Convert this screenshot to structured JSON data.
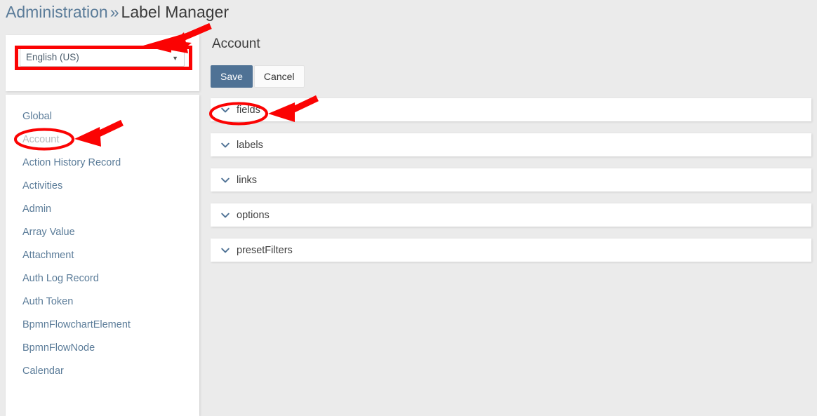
{
  "breadcrumb": {
    "root": "Administration",
    "separator": "»",
    "current": "Label Manager"
  },
  "language_selector": {
    "name": "language-select",
    "selected": "English (US)",
    "caret": "▼"
  },
  "sidebar": {
    "items": [
      {
        "label": "Global",
        "active": false
      },
      {
        "label": "Account",
        "active": true
      },
      {
        "label": "Action History Record",
        "active": false
      },
      {
        "label": "Activities",
        "active": false
      },
      {
        "label": "Admin",
        "active": false
      },
      {
        "label": "Array Value",
        "active": false
      },
      {
        "label": "Attachment",
        "active": false
      },
      {
        "label": "Auth Log Record",
        "active": false
      },
      {
        "label": "Auth Token",
        "active": false
      },
      {
        "label": "BpmnFlowchartElement",
        "active": false
      },
      {
        "label": "BpmnFlowNode",
        "active": false
      },
      {
        "label": "Calendar",
        "active": false
      }
    ]
  },
  "main": {
    "title": "Account",
    "buttons": {
      "save": "Save",
      "cancel": "Cancel"
    },
    "panels": [
      {
        "label": "fields",
        "icon": "chevron-down-icon"
      },
      {
        "label": "labels",
        "icon": "chevron-down-icon"
      },
      {
        "label": "links",
        "icon": "chevron-down-icon"
      },
      {
        "label": "options",
        "icon": "chevron-down-icon"
      },
      {
        "label": "presetFilters",
        "icon": "chevron-down-icon"
      }
    ]
  },
  "annotations": {
    "color": "#fb0303",
    "shapes": [
      {
        "type": "rectangle",
        "target": "language-select"
      },
      {
        "type": "arrow",
        "target": "language-select"
      },
      {
        "type": "ellipse",
        "target": "sidebar-item-account"
      },
      {
        "type": "arrow",
        "target": "sidebar-item-account"
      },
      {
        "type": "ellipse",
        "target": "panel-fields"
      },
      {
        "type": "arrow",
        "target": "panel-fields"
      }
    ]
  },
  "colors": {
    "page_background": "#ebebeb",
    "panel_background": "#ffffff",
    "link": "#5b7c99",
    "primary_button": "#4f7295",
    "annotation_red": "#fb0303"
  }
}
